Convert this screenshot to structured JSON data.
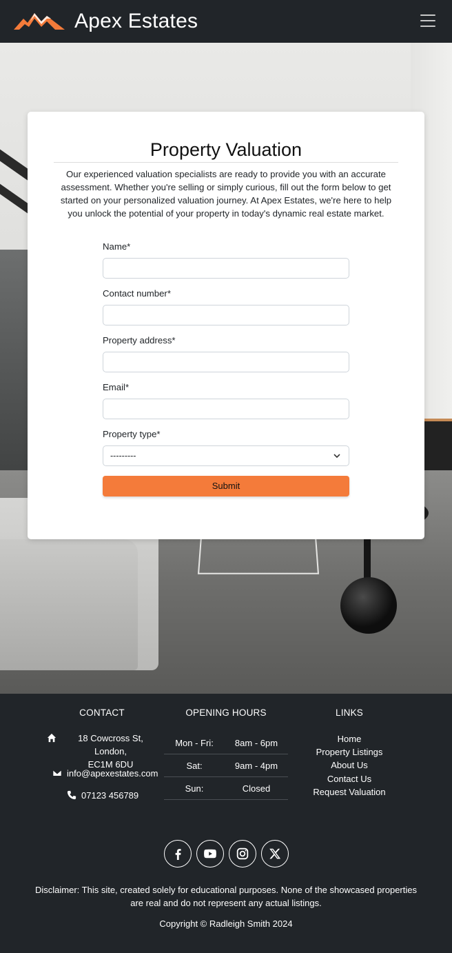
{
  "navbar": {
    "brand_name": "Apex Estates",
    "logo_icon": "mountain-logo-icon",
    "menu_icon": "hamburger-menu-icon"
  },
  "colors": {
    "accent": "#f47b3a",
    "dark": "#212529"
  },
  "valuation": {
    "title": "Property Valuation",
    "intro": "Our experienced valuation specialists are ready to provide you with an accurate assessment. Whether you're selling or simply curious, fill out the form below to get started on your personalized valuation journey. At Apex Estates, we're here to help you unlock the potential of your property in today's dynamic real estate market.",
    "fields": {
      "name_label": "Name*",
      "contact_label": "Contact number*",
      "address_label": "Property address*",
      "email_label": "Email*",
      "type_label": "Property type*",
      "type_selected": "---------"
    },
    "submit_label": "Submit"
  },
  "footer": {
    "contact": {
      "title": "CONTACT",
      "address_line1": "18 Cowcross St, London,",
      "address_line2": "EC1M 6DU",
      "email": "info@apexestates.com",
      "phone": "07123 456789"
    },
    "hours": {
      "title": "OPENING HOURS",
      "rows": [
        {
          "day": "Mon - Fri:",
          "time": "8am - 6pm"
        },
        {
          "day": "Sat:",
          "time": "9am - 4pm"
        },
        {
          "day": "Sun:",
          "time": "Closed"
        }
      ]
    },
    "links": {
      "title": "LINKS",
      "items": [
        "Home",
        "Property Listings",
        "About Us",
        "Contact Us",
        "Request Valuation"
      ]
    },
    "socials": [
      "facebook-icon",
      "youtube-icon",
      "instagram-icon",
      "x-twitter-icon"
    ],
    "disclaimer": "Disclaimer: This site, created solely for educational purposes. None of the showcased properties are real and do not represent any actual listings.",
    "copyright": "Copyright © Radleigh Smith 2024"
  }
}
